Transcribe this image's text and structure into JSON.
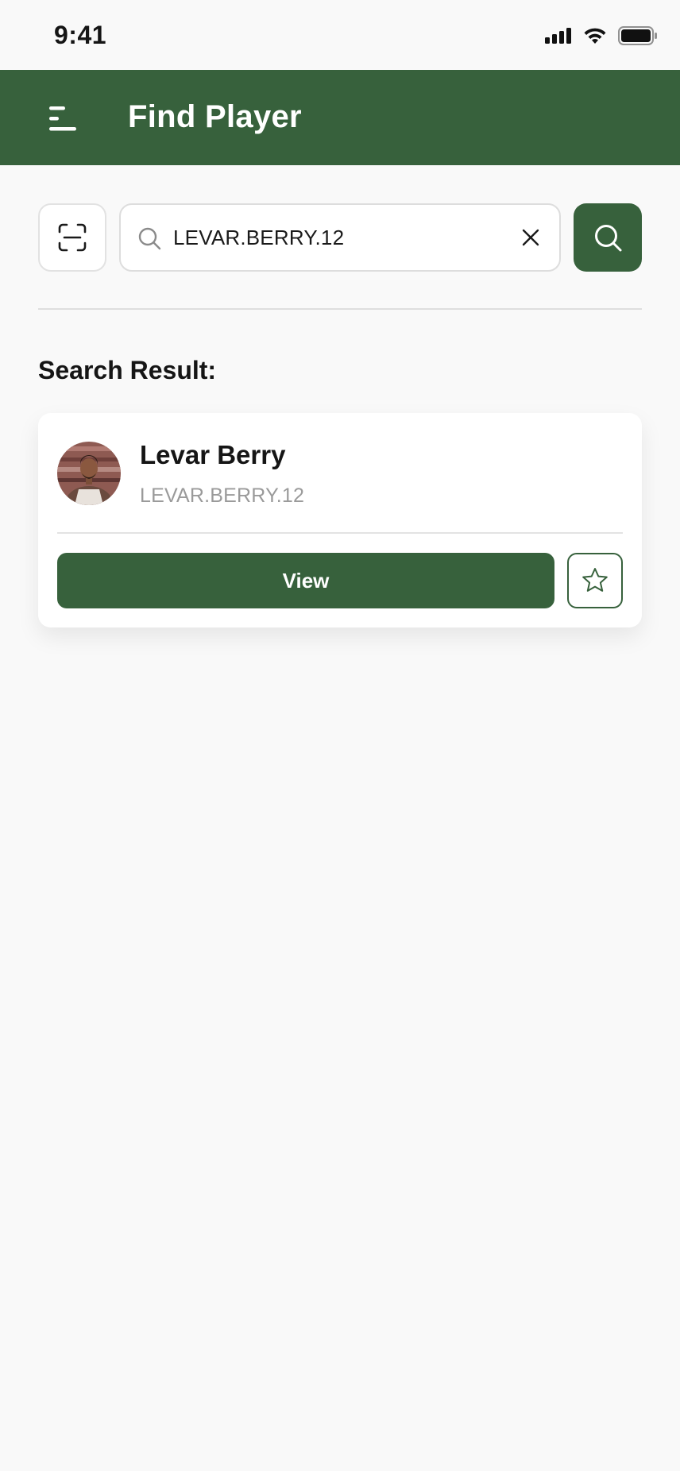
{
  "status_bar": {
    "time": "9:41",
    "icons": [
      "signal-icon",
      "wifi-icon",
      "battery-icon"
    ]
  },
  "header": {
    "title": "Find Player",
    "menu_icon": "menu-icon"
  },
  "search": {
    "value": "LEVAR.BERRY.12",
    "icons": [
      "scan-icon",
      "search-icon",
      "close-icon"
    ]
  },
  "results": {
    "heading": "Search Result:",
    "items": [
      {
        "name": "Levar Berry",
        "username": "LEVAR.BERRY.12",
        "view_label": "View",
        "favorite_icon": "star-icon"
      }
    ]
  },
  "colors": {
    "primary": "#37613c",
    "background": "#f9f9f9",
    "card": "#ffffff",
    "muted_text": "#9a9a9a"
  }
}
